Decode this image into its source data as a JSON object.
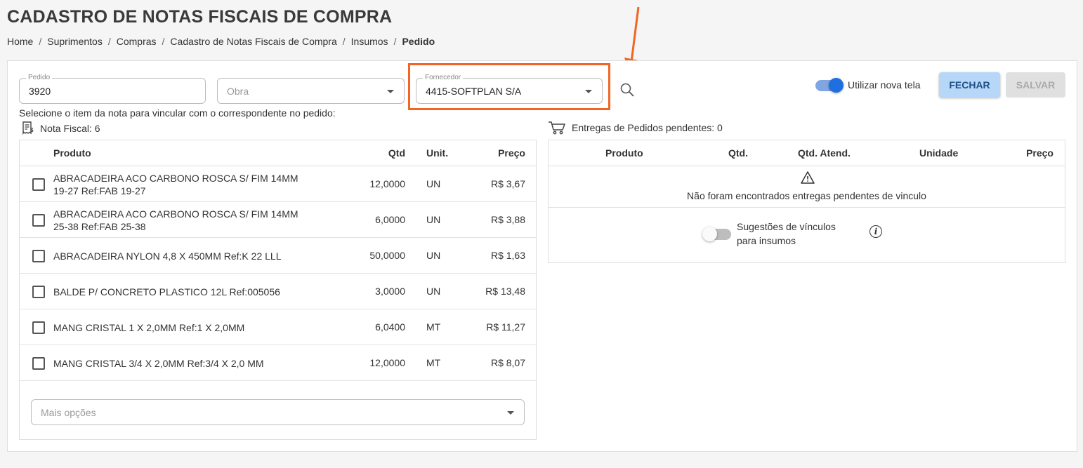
{
  "page": {
    "title": "CADASTRO DE NOTAS FISCAIS DE COMPRA",
    "breadcrumb": [
      "Home",
      "Suprimentos",
      "Compras",
      "Cadastro de Notas Fiscais de Compra",
      "Insumos"
    ],
    "breadcrumb_current": "Pedido"
  },
  "form": {
    "pedido_label": "Pedido",
    "pedido_value": "3920",
    "obra_placeholder": "Obra",
    "fornecedor_label": "Fornecedor",
    "fornecedor_value": "4415-SOFTPLAN S/A"
  },
  "toolbar": {
    "toggle_label": "Utilizar nova tela",
    "fechar_label": "FECHAR",
    "salvar_label": "SALVAR"
  },
  "instruction": "Selecione o item da nota para vincular com o correspondente no pedido:",
  "nota": {
    "heading": "Nota Fiscal: 6",
    "columns": {
      "produto": "Produto",
      "qtd": "Qtd",
      "unit": "Unit.",
      "preco": "Preço"
    },
    "rows": [
      {
        "produto_1": "ABRACADEIRA ACO CARBONO ROSCA S/ FIM 14MM",
        "produto_2": "19-27 Ref:FAB 19-27",
        "qtd": "12,0000",
        "unit": "UN",
        "preco": "R$ 3,67"
      },
      {
        "produto_1": "ABRACADEIRA ACO CARBONO ROSCA S/ FIM 14MM",
        "produto_2": "25-38 Ref:FAB 25-38",
        "qtd": "6,0000",
        "unit": "UN",
        "preco": "R$ 3,88"
      },
      {
        "produto_1": "ABRACADEIRA NYLON 4,8 X 450MM Ref:K 22 LLL",
        "produto_2": "",
        "qtd": "50,0000",
        "unit": "UN",
        "preco": "R$ 1,63"
      },
      {
        "produto_1": "BALDE P/ CONCRETO PLASTICO 12L Ref:005056",
        "produto_2": "",
        "qtd": "3,0000",
        "unit": "UN",
        "preco": "R$ 13,48"
      },
      {
        "produto_1": "MANG CRISTAL 1 X 2,0MM Ref:1 X 2,0MM",
        "produto_2": "",
        "qtd": "6,0400",
        "unit": "MT",
        "preco": "R$ 11,27"
      },
      {
        "produto_1": "MANG CRISTAL 3/4 X 2,0MM Ref:3/4 X 2,0 MM",
        "produto_2": "",
        "qtd": "12,0000",
        "unit": "MT",
        "preco": "R$ 8,07"
      }
    ],
    "mais_opcoes_placeholder": "Mais opções"
  },
  "entregas": {
    "heading": "Entregas de Pedidos pendentes: 0",
    "columns": {
      "produto": "Produto",
      "qtd": "Qtd.",
      "qtd_atend": "Qtd. Atend.",
      "unidade": "Unidade",
      "preco": "Preço"
    },
    "empty_message": "Não foram encontrados entregas pendentes de vinculo",
    "sugestoes_line1": "Sugestões de vínculos",
    "sugestoes_line2": "para insumos"
  },
  "colors": {
    "highlight": "#f26522",
    "accent": "#1f6fe0",
    "fechar_bg": "#b6d7f8"
  },
  "icons": [
    "search-icon",
    "invoice-icon",
    "cart-icon",
    "warning-icon",
    "info-icon",
    "arrow-down-annotation-icon"
  ]
}
